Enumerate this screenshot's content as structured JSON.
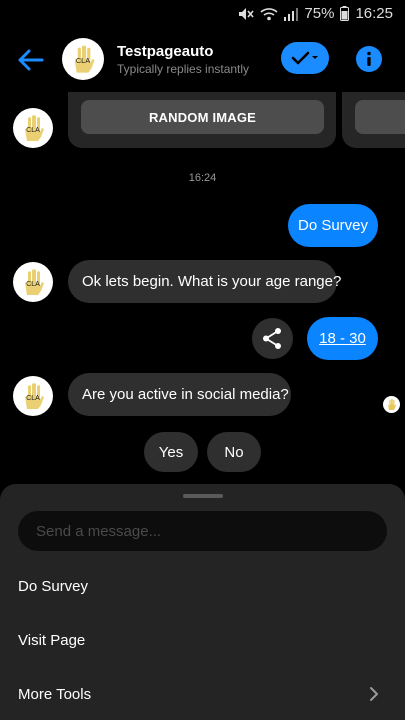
{
  "status_bar": {
    "battery": "75%",
    "time": "16:25"
  },
  "header": {
    "title": "Testpageauto",
    "subtitle": "Typically replies instantly"
  },
  "avatar": {
    "initials": "CLA"
  },
  "carousel": {
    "button_label": "RANDOM IMAGE"
  },
  "timestamp": "16:24",
  "messages": [
    {
      "from": "user",
      "text": "Do Survey"
    },
    {
      "from": "bot",
      "text": "Ok lets begin. What is your age range?"
    },
    {
      "from": "user",
      "text": "18 - 30"
    },
    {
      "from": "bot",
      "text": "Are you active in social media?"
    }
  ],
  "quick_replies": [
    "Yes",
    "No"
  ],
  "composer": {
    "placeholder": "Send a message..."
  },
  "menu": [
    {
      "label": "Do Survey"
    },
    {
      "label": "Visit Page"
    },
    {
      "label": "More Tools"
    }
  ],
  "colors": {
    "accent": "#0a84ff",
    "bubble_them": "#2f2f2f",
    "sheet": "#242424"
  },
  "icons": [
    "mute-icon",
    "wifi-icon",
    "signal-icon",
    "battery-icon",
    "back-arrow-icon",
    "check-icon",
    "info-icon",
    "share-icon",
    "chevron-right-icon"
  ]
}
